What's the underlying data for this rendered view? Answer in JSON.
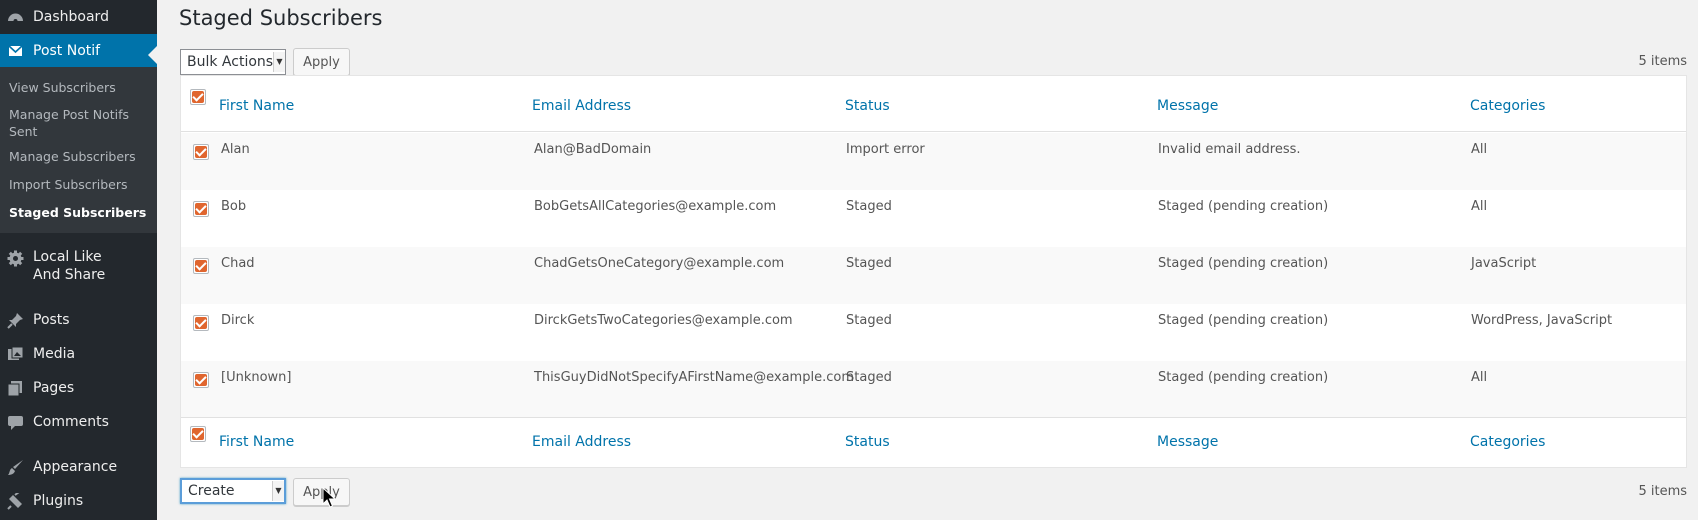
{
  "sidebar": {
    "dashboard": "Dashboard",
    "post_notif": "Post Notif",
    "submenu": [
      "View Subscribers",
      "Manage Post Notifs Sent",
      "Manage Subscribers",
      "Import Subscribers",
      "Staged Subscribers"
    ],
    "local_like": "Local Like And Share",
    "posts": "Posts",
    "media": "Media",
    "pages": "Pages",
    "comments": "Comments",
    "appearance": "Appearance",
    "plugins": "Plugins",
    "icons": [
      "dashboard-icon",
      "mail-icon",
      "gear-icon",
      "pin-icon",
      "media-icon",
      "pages-icon",
      "comment-icon",
      "brush-icon",
      "plugin-icon"
    ],
    "accent": "#0073aa"
  },
  "page": {
    "title": "Staged Subscribers",
    "top_bulk": "Bulk Actions",
    "top_apply": "Apply",
    "bottom_bulk": "Create",
    "bottom_apply": "Apply",
    "items_count": "5 items"
  },
  "table": {
    "columns": [
      "First Name",
      "Email Address",
      "Status",
      "Message",
      "Categories"
    ],
    "rows": [
      {
        "first": "Alan",
        "email": "Alan@BadDomain",
        "status": "Import error",
        "message": "Invalid email address.",
        "categories": "All"
      },
      {
        "first": "Bob",
        "email": "BobGetsAllCategories@example.com",
        "status": "Staged",
        "message": "Staged (pending creation)",
        "categories": "All"
      },
      {
        "first": "Chad",
        "email": "ChadGetsOneCategory@example.com",
        "status": "Staged",
        "message": "Staged (pending creation)",
        "categories": "JavaScript"
      },
      {
        "first": "Dirck",
        "email": "DirckGetsTwoCategories@example.com",
        "status": "Staged",
        "message": "Staged (pending creation)",
        "categories": "WordPress, JavaScript"
      },
      {
        "first": "[Unknown]",
        "email": "ThisGuyDidNotSpecifyAFirstName@example.com",
        "status": "Staged",
        "message": "Staged (pending creation)",
        "categories": "All"
      }
    ],
    "checkbox_color": "#e0662f"
  }
}
